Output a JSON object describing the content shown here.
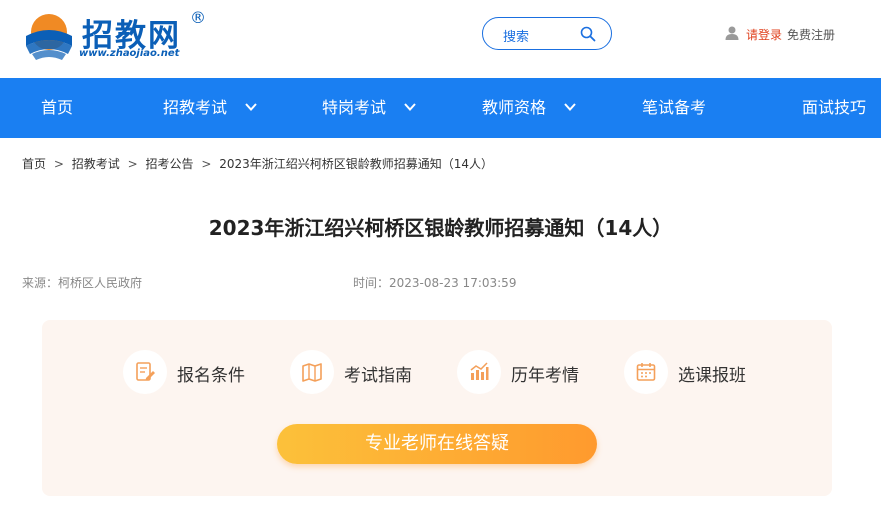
{
  "header": {
    "logo_text": "招教网",
    "logo_reg": "®",
    "logo_url": "www.zhaojiao.net",
    "search_label": "搜索",
    "login_label": "请登录",
    "register_label": "免费注册"
  },
  "nav": {
    "items": [
      {
        "label": "首页",
        "dropdown": false
      },
      {
        "label": "招教考试",
        "dropdown": true
      },
      {
        "label": "特岗考试",
        "dropdown": true
      },
      {
        "label": "教师资格",
        "dropdown": true
      },
      {
        "label": "笔试备考",
        "dropdown": false
      },
      {
        "label": "面试技巧",
        "dropdown": false
      }
    ]
  },
  "breadcrumb": {
    "items": [
      "首页",
      "招教考试",
      "招考公告",
      "2023年浙江绍兴柯桥区银龄教师招募通知（14人）"
    ],
    "separator": ">"
  },
  "article": {
    "title": "2023年浙江绍兴柯桥区银龄教师招募通知（14人）",
    "source": "来源：柯桥区人民政府",
    "time": "时间：2023-08-23 17:03:59"
  },
  "features": {
    "items": [
      {
        "label": "报名条件",
        "icon": "form-edit-icon"
      },
      {
        "label": "考试指南",
        "icon": "book-map-icon"
      },
      {
        "label": "历年考情",
        "icon": "bar-chart-icon"
      },
      {
        "label": "选课报班",
        "icon": "calendar-icon"
      }
    ],
    "cta_label": "专业老师在线答疑"
  },
  "colors": {
    "brand_blue": "#1a7ff2",
    "logo_blue": "#0b5fb7",
    "login_red": "#e0411e",
    "accent_orange": "#ff9a2e",
    "card_bg": "#fdf5f0"
  }
}
